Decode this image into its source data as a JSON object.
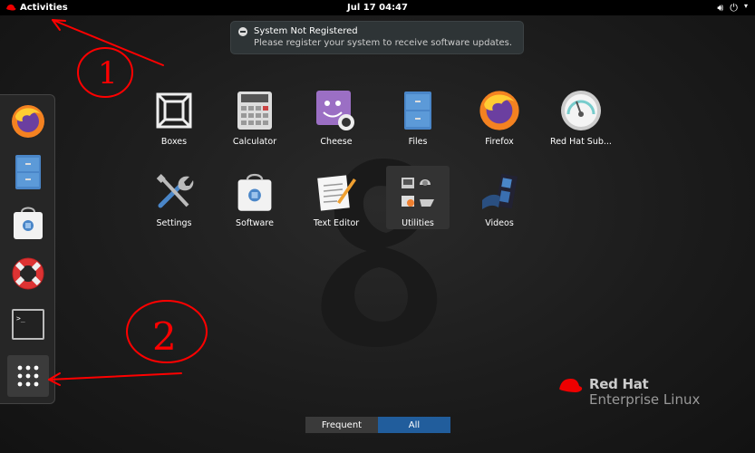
{
  "topbar": {
    "activities_label": "Activities",
    "clock": "Jul 17  04:47",
    "icons": [
      "speaker-icon",
      "power-icon",
      "chevron-down-icon"
    ]
  },
  "notification": {
    "title": "System Not Registered",
    "body": "Please register your system to receive software updates."
  },
  "dash": {
    "items": [
      "firefox-icon",
      "files-icon",
      "software-icon",
      "help-icon",
      "terminal-icon",
      "show-applications-icon"
    ]
  },
  "apps": [
    {
      "label": "Boxes"
    },
    {
      "label": "Calculator"
    },
    {
      "label": "Cheese"
    },
    {
      "label": "Files"
    },
    {
      "label": "Firefox"
    },
    {
      "label": "Red Hat Sub..."
    },
    {
      "label": "Settings"
    },
    {
      "label": "Software"
    },
    {
      "label": "Text Editor"
    },
    {
      "label": "Utilities"
    },
    {
      "label": "Videos"
    }
  ],
  "brand": {
    "line1": "Red Hat",
    "line2": "Enterprise Linux"
  },
  "tabs": {
    "frequent": "Frequent",
    "all": "All",
    "selected": "All"
  },
  "annotations": {
    "mark1": "1",
    "mark2": "2",
    "color": "#ff0000"
  },
  "colors": {
    "accent": "#215d9c",
    "redhat": "#ee0000"
  }
}
